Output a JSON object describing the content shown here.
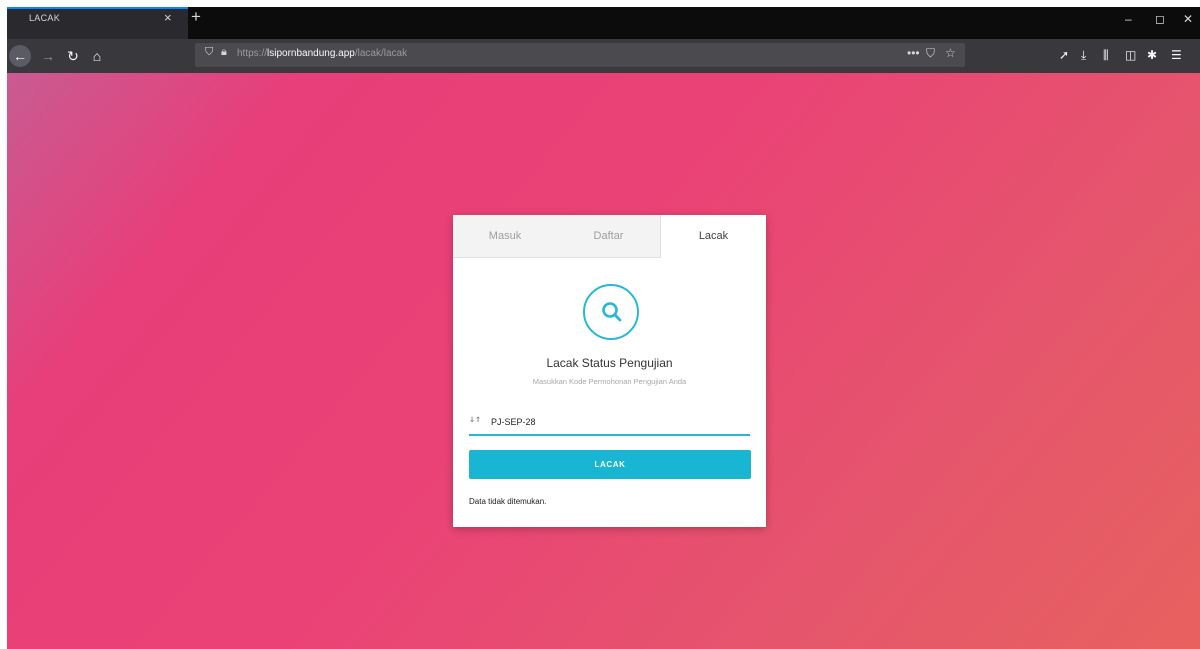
{
  "browser": {
    "tab_title": "LACAK",
    "tab_close": "×",
    "new_tab": "+",
    "window_controls": [
      "–",
      "◻",
      "✕"
    ],
    "url": {
      "scheme": "https://",
      "host": "lsipornbandung.app",
      "path": "/lacak/lacak"
    },
    "url_actions": [
      "•••",
      "⛉",
      "☆"
    ],
    "toolbar_icons": [
      "➚",
      "⤓",
      "⫼",
      "◫",
      "✱",
      "☰"
    ]
  },
  "colors": {
    "accent": "#18b6d3",
    "background_start": "#c95b92",
    "background_end": "#e8615f"
  },
  "auth_tabs": [
    {
      "label": "Masuk",
      "active": false
    },
    {
      "label": "Daftar",
      "active": false
    },
    {
      "label": "Lacak",
      "active": true
    }
  ],
  "card": {
    "icon": "search-icon",
    "title": "Lacak Status Pengujian",
    "subtitle": "Masukkan Kode Permohonan Pengujian Anda",
    "input_icon": "sort-icon",
    "input_value": "PJ-SEP-28",
    "button_label": "LACAK",
    "result_message": "Data tidak ditemukan."
  }
}
